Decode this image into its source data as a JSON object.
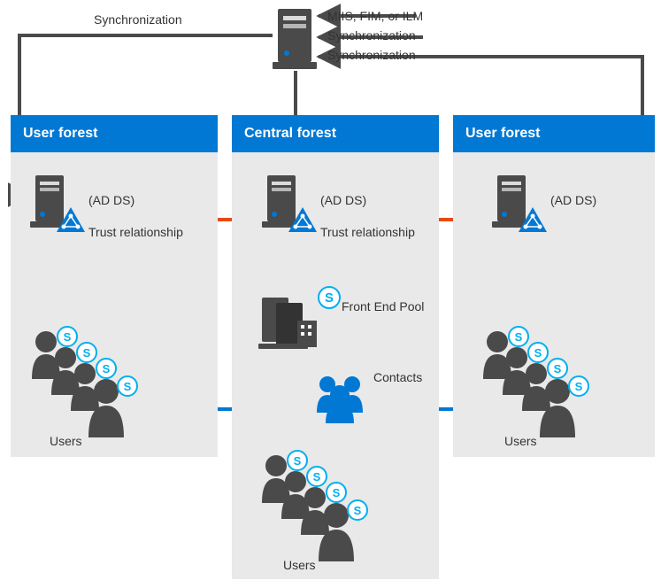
{
  "forests": {
    "left": {
      "title": "User forest",
      "ad_label": "(AD DS)",
      "trust_label": "Trust relationship",
      "users_label": "Users"
    },
    "center": {
      "title": "Central forest",
      "ad_label": "(AD DS)",
      "trust_label": "Trust relationship",
      "front_end_label": "Front End Pool",
      "contacts_label": "Contacts",
      "users_label": "Users"
    },
    "right": {
      "title": "User forest",
      "ad_label": "(AD DS)",
      "users_label": "Users"
    }
  },
  "top": {
    "miis_label": "MIIS, FIM, or ILM",
    "sync_label_left": "Synchronization",
    "sync_label_r1": "Synchronization",
    "sync_label_r2": "Synchronization"
  }
}
